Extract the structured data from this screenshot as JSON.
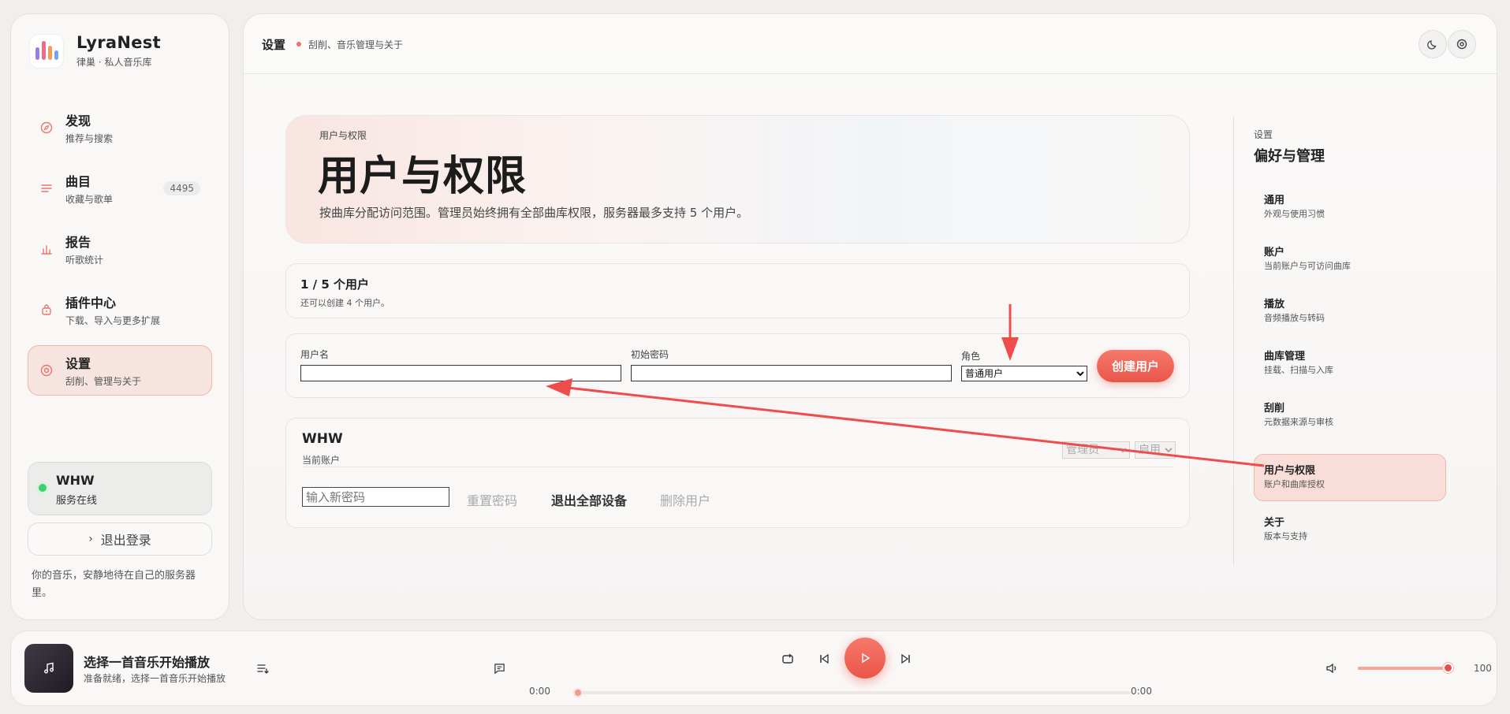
{
  "brand": {
    "name": "LyraNest",
    "subtitle": "律巢 · 私人音乐库"
  },
  "nav": {
    "items": [
      {
        "title": "发现",
        "subtitle": "推荐与搜索",
        "icon": "compass-icon"
      },
      {
        "title": "曲目",
        "subtitle": "收藏与歌单",
        "icon": "list-icon",
        "badge": "4495"
      },
      {
        "title": "报告",
        "subtitle": "听歌统计",
        "icon": "bar-chart-icon"
      },
      {
        "title": "插件中心",
        "subtitle": "下载、导入与更多扩展",
        "icon": "plugin-icon"
      },
      {
        "title": "设置",
        "subtitle": "刮削、管理与关于",
        "icon": "settings-icon",
        "active": true
      }
    ]
  },
  "server": {
    "name": "WHW",
    "status": "服务在线"
  },
  "logout_label": "退出登录",
  "tagline": "你的音乐，安静地待在自己的服务器里。",
  "topbar": {
    "title": "设置",
    "subtitle": "刮削、音乐管理与关于"
  },
  "hero": {
    "kicker": "用户与权限",
    "title": "用户与权限",
    "description": "按曲库分配访问范围。管理员始终拥有全部曲库权限，服务器最多支持 5 个用户。"
  },
  "users_count": {
    "title": "1 / 5 个用户",
    "subtitle": "还可以创建 4 个用户。"
  },
  "create_form": {
    "username_label": "用户名",
    "username_value": "",
    "password_label": "初始密码",
    "password_value": "",
    "role_label": "角色",
    "role_selected": "普通用户",
    "create_button": "创建用户"
  },
  "user_card": {
    "name": "WHW",
    "subtitle": "当前账户",
    "role_selected": "管理员",
    "status_selected": "启用",
    "new_password_placeholder": "输入新密码",
    "reset_password": "重置密码",
    "logout_all": "退出全部设备",
    "delete_user": "删除用户"
  },
  "settings_nav": {
    "kicker": "设置",
    "title": "偏好与管理",
    "items": [
      {
        "title": "通用",
        "subtitle": "外观与使用习惯"
      },
      {
        "title": "账户",
        "subtitle": "当前账户与可访问曲库"
      },
      {
        "title": "播放",
        "subtitle": "音频播放与转码"
      },
      {
        "title": "曲库管理",
        "subtitle": "挂载、扫描与入库"
      },
      {
        "title": "刮削",
        "subtitle": "元数据来源与审核"
      },
      {
        "title": "用户与权限",
        "subtitle": "账户和曲库授权",
        "active": true
      },
      {
        "title": "关于",
        "subtitle": "版本与支持"
      }
    ]
  },
  "player": {
    "title": "选择一首音乐开始播放",
    "subtitle": "准备就绪，选择一首音乐开始播放",
    "time_current": "0:00",
    "time_total": "0:00",
    "progress": 0,
    "volume": 100,
    "volume_label": "100"
  },
  "colors": {
    "accent": "#e9554a",
    "active_bg": "#f6e4e1",
    "annotation_arrow": "#ef4c4c"
  }
}
